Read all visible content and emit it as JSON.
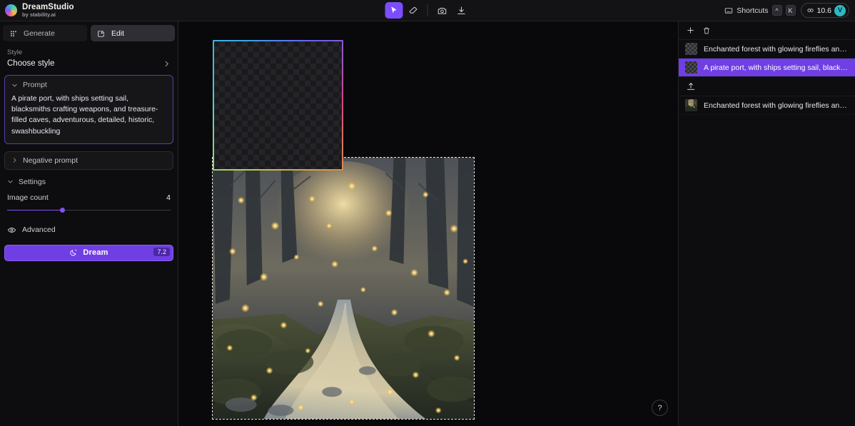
{
  "brand": {
    "title": "DreamStudio",
    "subtitle": "by stability.ai",
    "logo_icon": "dreamstudio-logo"
  },
  "toolbar": {
    "tools": [
      {
        "name": "select-tool",
        "icon": "cursor-icon",
        "active": true
      },
      {
        "name": "eraser-tool",
        "icon": "eraser-icon",
        "active": false
      },
      {
        "name": "screenshot-tool",
        "icon": "camera-icon",
        "active": false
      },
      {
        "name": "download-tool",
        "icon": "download-icon",
        "active": false
      }
    ]
  },
  "topright": {
    "shortcuts_label": "Shortcuts",
    "shortcuts_icon": "keyboard-icon",
    "key_modifier": "^",
    "key_letter": "K",
    "credits_value": "10.6",
    "credits_icon": "credits-icon",
    "avatar_initial": "V",
    "avatar_color": "#2bb8c4"
  },
  "left_panel": {
    "mode_tabs": [
      {
        "label": "Generate",
        "icon": "grid-icon",
        "active": false
      },
      {
        "label": "Edit",
        "icon": "pencil-square-icon",
        "active": true
      }
    ],
    "style": {
      "label": "Style",
      "value": "Choose style",
      "chevron": "chevron-right-icon"
    },
    "prompt": {
      "label": "Prompt",
      "chevron": "chevron-down-icon",
      "value": "A pirate port, with ships setting sail, blacksmiths crafting weapons, and treasure-filled caves, adventurous, detailed, historic, swashbuckling",
      "border_color": "#5a3fa8"
    },
    "negative_prompt": {
      "label": "Negative prompt",
      "chevron": "chevron-right-icon"
    },
    "settings": {
      "label": "Settings",
      "chevron": "chevron-down-icon",
      "image_count": {
        "label": "Image count",
        "value": "4",
        "slider_percent": 34
      }
    },
    "advanced": {
      "label": "Advanced",
      "icon": "eye-icon"
    },
    "dream_button": {
      "label": "Dream",
      "icon": "moon-sparkle-icon",
      "cost": "7.2",
      "color": "#6f3fe4"
    }
  },
  "canvas": {
    "selection_box": {
      "name": "transparent-selection-box",
      "type": "checkerboard"
    },
    "image_frame": {
      "name": "generated-image-frame",
      "alt": "Enchanted forest with glowing fireflies and a babbling brook"
    },
    "help_button": {
      "label": "?"
    }
  },
  "right_panel": {
    "header": {
      "add_icon": "plus-icon",
      "delete_icon": "trash-icon"
    },
    "layers": [
      {
        "label": "Enchanted forest with glowing fireflies and a bab...",
        "thumb": "checkerboard",
        "selected": false
      },
      {
        "label": "A pirate port, with ships setting sail, blacksmiths ...",
        "thumb": "checkerboard",
        "selected": true
      }
    ],
    "upload_row": {
      "icon": "upload-icon"
    },
    "uploaded": [
      {
        "label": "Enchanted forest with glowing fireflies and a bab...",
        "thumb": "forest-photo",
        "selected": false
      }
    ]
  }
}
